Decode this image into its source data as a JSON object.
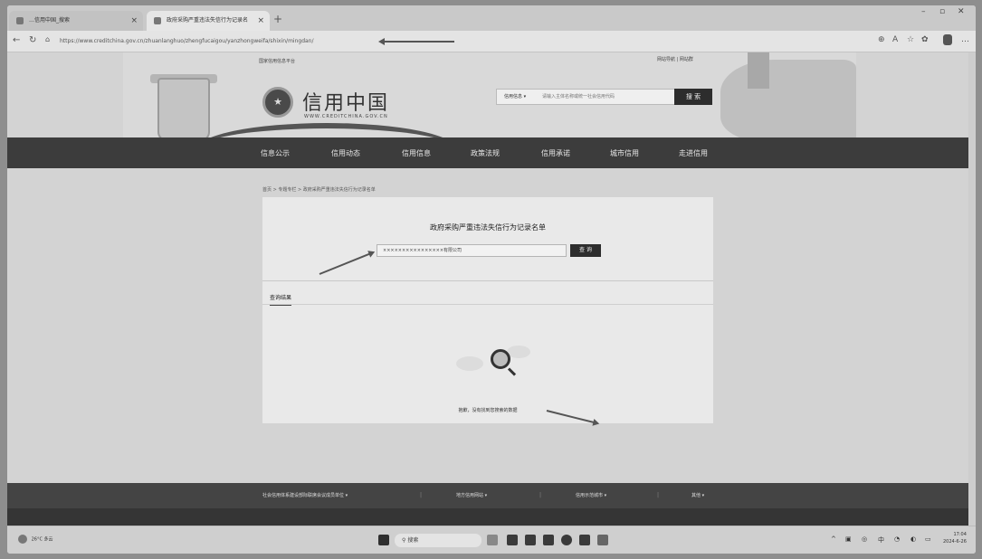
{
  "browser": {
    "tabs": [
      {
        "label": "…信用中国_搜索",
        "active": false
      },
      {
        "label": "政府采购严重违法失信行为记录名",
        "active": true
      }
    ],
    "url": "https://www.creditchina.gov.cn/zhuanlanghuo/zhengfucaigou/yanzhongweifa/shixin/mingdan/",
    "close_glyph": "×",
    "new_tab_glyph": "+"
  },
  "site": {
    "top_left_text": "国家信用信息平台",
    "top_links": "网站导航 | 网站群",
    "title": "信用中国",
    "url_text": "WWW.CREDITCHINA.GOV.CN",
    "search": {
      "type_label": "信用信息 ▾",
      "placeholder": "请输入主体名称或统一社会信用代码",
      "button": "搜 索"
    },
    "nav": [
      "信息公示",
      "信用动态",
      "信用信息",
      "政策法规",
      "信用承诺",
      "城市信用",
      "走进信用"
    ]
  },
  "breadcrumb": "首页 > 专题专栏 > 政府采购严重违法失信行为记录名单",
  "card": {
    "title": "政府采购严重违法失信行为记录名单",
    "query_value": "××××××××××××××××有限公司",
    "query_button": "查 询",
    "results_tab": "查询结果",
    "empty_text": "抱歉，没有找到您搜索的数据"
  },
  "footer": {
    "items": [
      "社会信用体系建设部际联席会议成员单位 ▾",
      "地方信用网站 ▾",
      "信用示范城市 ▾",
      "其他 ▾"
    ]
  },
  "taskbar": {
    "weather_temp": "26°C",
    "weather_desc": "多云",
    "search_label": "搜索",
    "time": "17:04",
    "date": "2024-6-26"
  },
  "colors": {
    "nav_bg": "#3c3c3c",
    "button_bg": "#2d2d2d",
    "card_bg": "#e9e9e9"
  }
}
